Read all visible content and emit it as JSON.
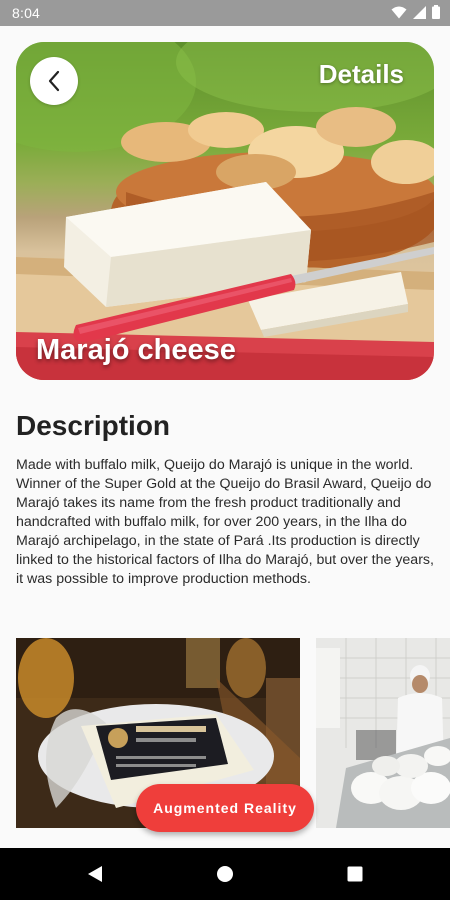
{
  "status_bar": {
    "time": "8:04"
  },
  "header": {
    "title": "Details"
  },
  "hero": {
    "name": "Marajó cheese"
  },
  "description": {
    "heading": "Description",
    "text": "Made with buffalo milk, Queijo do Marajó is unique in the world. Winner of the Super Gold at the Queijo do Brasil Award, Queijo do Marajó takes its name from the fresh product traditionally and handcrafted with buffalo milk, for over 200 years, in the Ilha do Marajó archipelago, in the state of Pará .Its production is directly linked to the historical factors of Ilha do Marajó, but over the years, it was possible to improve production methods."
  },
  "gallery": {
    "items": [
      {
        "alt": "packaged-cheese-photo"
      },
      {
        "alt": "cheese-production-photo"
      }
    ]
  },
  "ar_button": {
    "label": "Augmented Reality"
  },
  "colors": {
    "accent": "#ef3e3b",
    "status_bar": "#9a9a9a",
    "nav_bar": "#000000"
  },
  "icons": [
    "wifi-icon",
    "cellular-signal-icon",
    "battery-icon",
    "back-arrow-icon",
    "nav-back-icon",
    "nav-home-icon",
    "nav-recents-icon"
  ]
}
